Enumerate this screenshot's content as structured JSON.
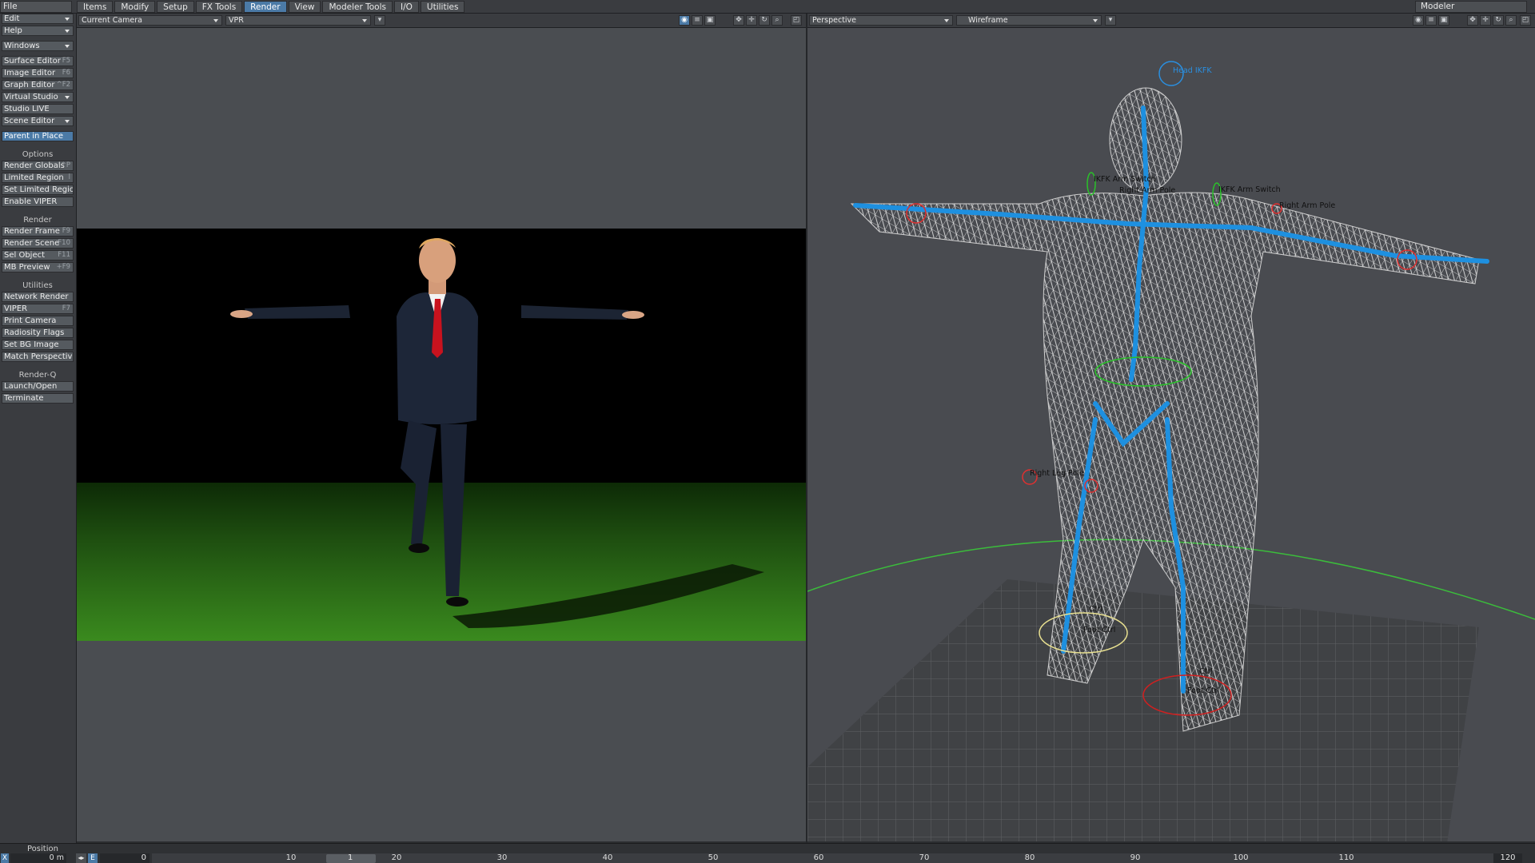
{
  "menu": {
    "file": "File"
  },
  "tabs": [
    {
      "label": "Items"
    },
    {
      "label": "Modify"
    },
    {
      "label": "Setup"
    },
    {
      "label": "FX Tools"
    },
    {
      "label": "Render"
    },
    {
      "label": "View"
    },
    {
      "label": "Modeler Tools"
    },
    {
      "label": "I/O"
    },
    {
      "label": "Utilities"
    }
  ],
  "modeler_button": "Modeler",
  "sidebar": {
    "edit": "Edit",
    "help": "Help",
    "windows": "Windows",
    "items": [
      {
        "label": "Surface Editor",
        "shortcut": "F5"
      },
      {
        "label": "Image Editor",
        "shortcut": "F6"
      },
      {
        "label": "Graph Editor",
        "shortcut": "^F2"
      },
      {
        "label": "Virtual Studio",
        "shortcut": ""
      },
      {
        "label": "Studio LIVE",
        "shortcut": ""
      },
      {
        "label": "Scene Editor",
        "shortcut": ""
      },
      {
        "label": "Parent in Place",
        "shortcut": ""
      }
    ],
    "options_header": "Options",
    "options": [
      {
        "label": "Render Globals",
        "shortcut": "^P"
      },
      {
        "label": "Limited Region",
        "shortcut": "l"
      },
      {
        "label": "Set Limited Region",
        "shortcut": ""
      },
      {
        "label": "Enable VIPER",
        "shortcut": ""
      }
    ],
    "render_header": "Render",
    "render": [
      {
        "label": "Render Frame",
        "shortcut": "F9"
      },
      {
        "label": "Render Scene",
        "shortcut": "F10"
      },
      {
        "label": "Sel Object",
        "shortcut": "F11"
      },
      {
        "label": "MB Preview",
        "shortcut": "+F9"
      }
    ],
    "utilities_header": "Utilities",
    "utilities": [
      {
        "label": "Network Render",
        "shortcut": ""
      },
      {
        "label": "VIPER",
        "shortcut": "F7"
      },
      {
        "label": "Print Camera",
        "shortcut": ""
      },
      {
        "label": "Radiosity Flags",
        "shortcut": ""
      },
      {
        "label": "Set BG Image",
        "shortcut": ""
      },
      {
        "label": "Match Perspective",
        "shortcut": ""
      }
    ],
    "renderq_header": "Render-Q",
    "renderq": [
      {
        "label": "Launch/Open",
        "shortcut": ""
      },
      {
        "label": "Terminate",
        "shortcut": ""
      }
    ]
  },
  "viewport_left": {
    "camera": "Current Camera",
    "mode": "VPR"
  },
  "viewport_right": {
    "view": "Perspective",
    "shading": "Wireframe"
  },
  "rig_labels": {
    "head": "Head IKFK",
    "arm_switch_l": "IKFK Arm Switch",
    "arm_switch_r": "IKFK Arm Switch",
    "arm_pole_r": "Right Arm Pole",
    "arm_pole_l": "Right Arm Pole",
    "leg_pole": "Right Leg Pole",
    "ctrl1": "Ctrl",
    "foot_ctrl1": "Foot Ctrl",
    "ctrl2": "Ctrl",
    "foot_ctrl2": "Foot Ctrl"
  },
  "timeline": {
    "position_label": "Position",
    "axis": "X",
    "value": "0 m",
    "e_label": "E",
    "frame": "0",
    "slider_frame": "1",
    "end_frame": "120",
    "ticks": [
      "10",
      "20",
      "30",
      "40",
      "50",
      "60",
      "70",
      "80",
      "90",
      "100",
      "110"
    ]
  },
  "colors": {
    "accent": "#4b7aa6",
    "ground_green": "#2e6b18",
    "bone_blue": "#1e90e0"
  }
}
